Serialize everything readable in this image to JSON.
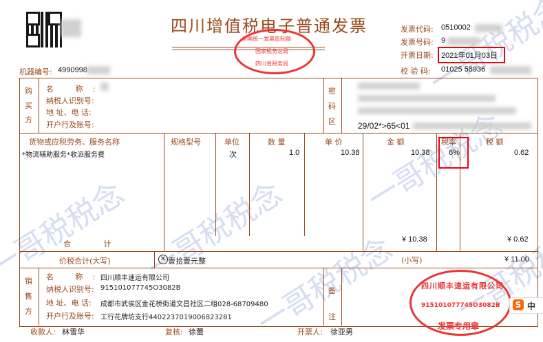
{
  "invoice": {
    "title": "四川增值税电子普通发票",
    "code_label": "发票代码:",
    "code_value": "0510002",
    "number_label": "发票号码:",
    "number_value": "9",
    "date_label": "开票日期:",
    "date_value": "2021年01月03日",
    "check_label": "校 验 码:",
    "check_value": "01025 58936",
    "machine_label": "机器编号:",
    "machine_value": "4990998"
  },
  "seal_top": {
    "line1": "全国统一发票监制章",
    "line2": "国家税务总局",
    "line3": "四川省税务局"
  },
  "buyer": {
    "side": "购买方",
    "name_label": "名 称:",
    "tax_label": "纳税人识别号:",
    "addr_label": "地 址、电 话:",
    "bank_label": "开户行及账号:"
  },
  "cipher": {
    "side": "密码区",
    "line4": "29/02*>65<01"
  },
  "table": {
    "headers": [
      "货物或应税劳务、服务名称",
      "规格型号",
      "单位",
      "数 量",
      "单 价",
      "金 额",
      "税率",
      "税 额"
    ],
    "row": {
      "name": "*物流辅助服务*收派服务费",
      "unit": "次",
      "qty": "1.0",
      "price": "10.38",
      "amount": "10.38",
      "rate": "6%",
      "tax": "0.62"
    },
    "total_label": "合 计",
    "total_amount": "¥ 10.38",
    "total_tax": "¥ 0.62"
  },
  "total": {
    "label": "价税合计(大写)",
    "upper": "壹拾壹元整",
    "lower_label": "(小写)",
    "lower_value": "¥ 11.00"
  },
  "seller": {
    "side": "销售方",
    "name_label": "名 称:",
    "name_value": "四川顺丰速运有限公司",
    "tax_label": "纳税人识别号:",
    "tax_value": "915101077745O3082B",
    "addr_label": "地 址、电 话:",
    "addr_value": "成都市武侯区金花桥街道文昌社区二组028-68709480",
    "bank_label": "开户行及账号:",
    "bank_value": "工行花牌坊支行4402237019006823281"
  },
  "remark": {
    "side": "备注"
  },
  "seal_seller": {
    "top": "四川顺丰速运有限公司",
    "number": "915101077745O3082B",
    "bottom": "发票专用章"
  },
  "footer": {
    "payee_label": "收款人:",
    "payee_value": "林雪华",
    "reviewer_label": "复核:",
    "reviewer_value": "徐蕾",
    "drawer_label": "开票人:",
    "drawer_value": "徐亚男"
  },
  "watermark": {
    "text": "一哥税税念"
  },
  "ime": {
    "lang": "中"
  }
}
